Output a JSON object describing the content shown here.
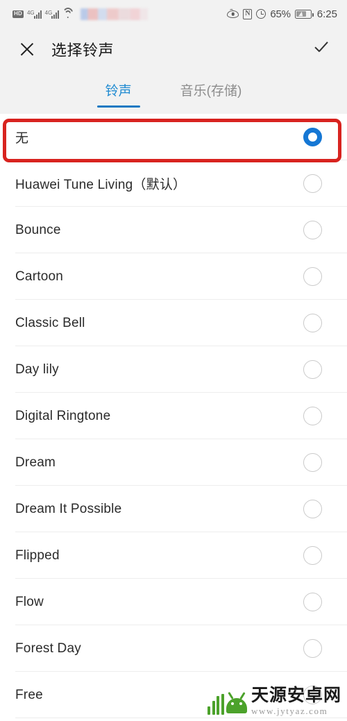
{
  "statusbar": {
    "hd_label": "HD",
    "sim1_network": "4G",
    "sim2_network": "4G",
    "carrier_redacted": "",
    "battery_percent": "65%",
    "time": "6:25",
    "icons": [
      "hd-badge",
      "signal-bars-icon",
      "signal-bars-icon",
      "wifi-icon",
      "eye-comfort-icon",
      "nfc-icon",
      "alarm-clock-icon",
      "battery-charging-icon"
    ]
  },
  "appbar": {
    "close_label": "✕",
    "title": "选择铃声",
    "confirm_label": "✓"
  },
  "tabs": {
    "active_index": 0,
    "items": [
      {
        "label": "铃声"
      },
      {
        "label": "音乐(存储)"
      }
    ]
  },
  "list": {
    "selected_index": 0,
    "items": [
      {
        "label": "无",
        "selected": true
      },
      {
        "label": "Huawei Tune Living（默认）",
        "selected": false
      },
      {
        "label": "Bounce",
        "selected": false
      },
      {
        "label": "Cartoon",
        "selected": false
      },
      {
        "label": "Classic Bell",
        "selected": false
      },
      {
        "label": "Day lily",
        "selected": false
      },
      {
        "label": "Digital Ringtone",
        "selected": false
      },
      {
        "label": "Dream",
        "selected": false
      },
      {
        "label": "Dream It Possible",
        "selected": false
      },
      {
        "label": "Flipped",
        "selected": false
      },
      {
        "label": "Flow",
        "selected": false
      },
      {
        "label": "Forest Day",
        "selected": false
      },
      {
        "label": "Free",
        "selected": false
      }
    ]
  },
  "annotation": {
    "highlight_color": "#d8231f",
    "highlight_target": "无"
  },
  "watermark": {
    "site_name": "天源安卓网",
    "url": "www.jytyaz.com",
    "logo_color": "#4ca22b"
  },
  "colors": {
    "accent_blue": "#1577d4",
    "tab_active": "#1f8ad1",
    "bar_background": "#f2f2f2",
    "list_background": "#ffffff",
    "text_primary": "#2b2b2b",
    "text_muted": "#8d8d8d"
  }
}
